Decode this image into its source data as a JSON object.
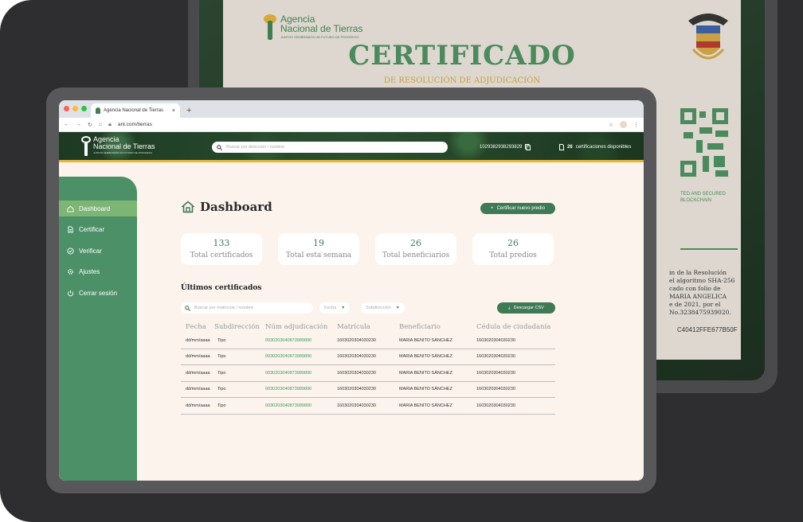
{
  "certificate": {
    "logo_name_1": "Agencia",
    "logo_name_2": "Nacional de Tierras",
    "logo_tagline": "JUNTOS SEMBRAMOS UN FUTURO DE PROGRESO",
    "title": "CERTIFICADO",
    "subtitle": "DE RESOLUCIÓN DE ADJUDICACIÓN",
    "secured_text_1": "TED AND SECURED",
    "secured_text_2": "BLOCKCHAIN",
    "body_lines": [
      "in de la Resolución",
      "el algoritmo SHA-256",
      "cado con folio de",
      "MARIA ANGELICA",
      "e de 2021, por el",
      "No.3238475939020."
    ],
    "hash": "C40412FFE677B50F"
  },
  "browser": {
    "tab_title": "Agencia Nacional de Tierras",
    "tab_close": "×",
    "new_tab": "+",
    "url": "ant.com/tierras"
  },
  "header": {
    "logo_name_1": "Agencia",
    "logo_name_2": "Nacional de Tierras",
    "logo_tagline": "JUNTOS SEMBRAMOS UN FUTURO DE PROGRESO",
    "search_placeholder": "Buscar por dirección / nombre",
    "account_id": "1029382938293829",
    "available_count": "26",
    "available_label": "certificaciones disponibles"
  },
  "sidebar": {
    "items": [
      {
        "label": "Dashboard",
        "icon": "home-icon",
        "active": true
      },
      {
        "label": "Certificar",
        "icon": "document-icon",
        "active": false
      },
      {
        "label": "Verificar",
        "icon": "check-circle-icon",
        "active": false
      },
      {
        "label": "Ajustes",
        "icon": "gear-icon",
        "active": false
      },
      {
        "label": "Cerrar sesión",
        "icon": "power-icon",
        "active": false
      }
    ]
  },
  "main": {
    "title": "Dashboard",
    "cta_label": "Certificar nuevo predio",
    "stats": [
      {
        "value": "133",
        "label": "Total certificados"
      },
      {
        "value": "19",
        "label": "Total esta semana"
      },
      {
        "value": "26",
        "label": "Total beneficiarios"
      },
      {
        "value": "26",
        "label": "Total predios"
      }
    ],
    "section_title": "Últimos certificados",
    "filter_search_placeholder": "Buscar por matrícula / nombre",
    "filter_date": "Fecha",
    "filter_subdir": "Subdirección",
    "download_label": "Descargar CSV",
    "columns": [
      "Fecha",
      "Subdirección",
      "Núm adjudicación",
      "Matrícula",
      "Beneficiario",
      "Cédula de ciudadanía"
    ],
    "rows": [
      [
        "dd/mm/aaaa",
        "Tipo",
        "0030203040873989890",
        "1603020304030230",
        "MARIA BENITO SÁNCHEZ",
        "1603020304030230"
      ],
      [
        "dd/mm/aaaa",
        "Tipo",
        "0030203040873989890",
        "1603020304030230",
        "MARIA BENITO SÁNCHEZ",
        "1603020304030230"
      ],
      [
        "dd/mm/aaaa",
        "Tipo",
        "0030203040873989890",
        "1603020304030230",
        "MARIA BENITO SÁNCHEZ",
        "1603020304030230"
      ],
      [
        "dd/mm/aaaa",
        "Tipo",
        "0030203040873989890",
        "1603020304030230",
        "MARIA BENITO SÁNCHEZ",
        "1603020304030230"
      ],
      [
        "dd/mm/aaaa",
        "Tipo",
        "0030203040873989890",
        "1603020304030230",
        "MARIA BENITO SÁNCHEZ",
        "1603020304030230"
      ]
    ]
  },
  "colors": {
    "brand_green": "#3e7a54",
    "sidebar_green": "#4c9068",
    "active_green": "#7db575",
    "gold": "#e5b53d",
    "background": "#fbf3ec"
  }
}
